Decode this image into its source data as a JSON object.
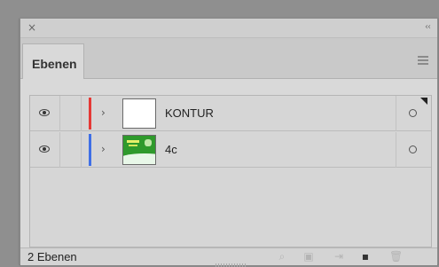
{
  "panel": {
    "close_glyph": "×",
    "collapse_glyph": "‹‹",
    "tab_label": "Ebenen",
    "menu_icon": "panel-menu-icon"
  },
  "layers": [
    {
      "name": "KONTUR",
      "color": "#e53935",
      "visible": true,
      "thumbnail": "blank-white"
    },
    {
      "name": "4c",
      "color": "#3f6fe6",
      "visible": true,
      "thumbnail": "green-artwork"
    }
  ],
  "footer": {
    "status": "2 Ebenen",
    "tools": [
      {
        "name": "locate-object-icon",
        "glyph": "⌕"
      },
      {
        "name": "make-clipping-mask-icon",
        "glyph": "▣"
      },
      {
        "name": "create-sublayer-icon",
        "glyph": "⇥"
      },
      {
        "name": "create-new-layer-icon",
        "glyph": "▪"
      },
      {
        "name": "delete-icon",
        "glyph": "🗑"
      }
    ]
  }
}
